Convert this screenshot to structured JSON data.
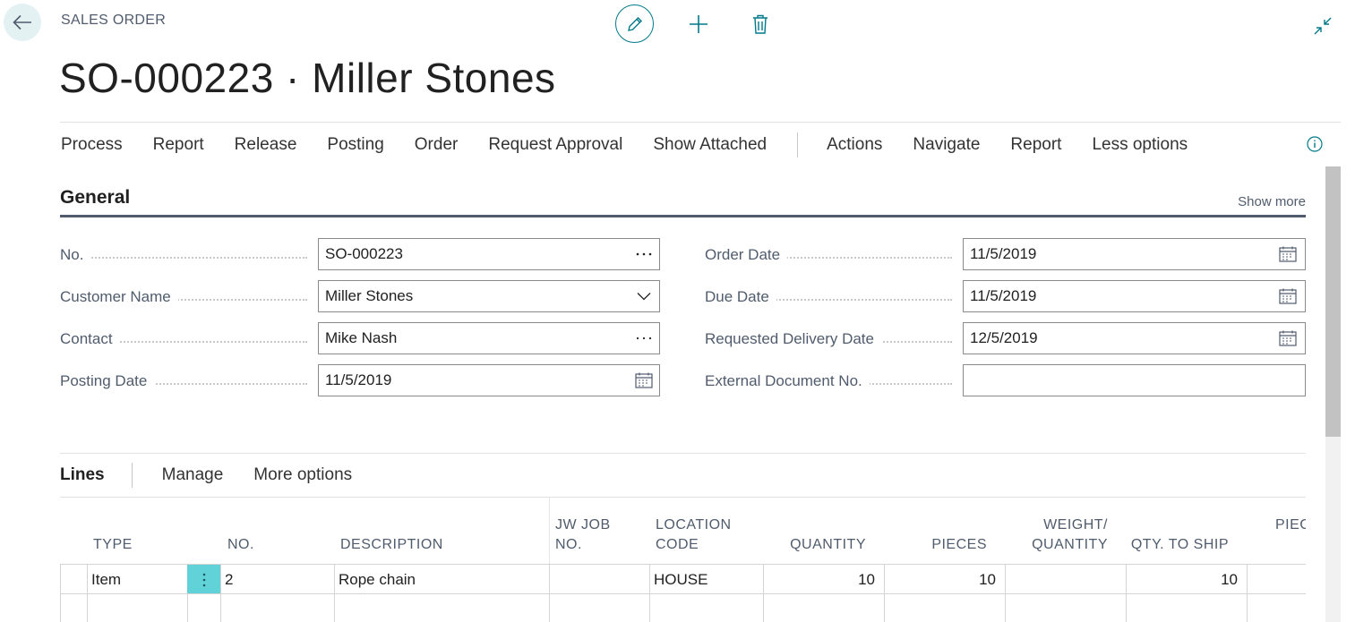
{
  "header": {
    "breadcrumb": "SALES ORDER",
    "title": "SO-000223 · Miller Stones"
  },
  "icons": {
    "back": "arrow-left-icon",
    "edit": "pencil-icon",
    "new": "plus-icon",
    "delete": "trash-icon",
    "collapse": "collapse-icon",
    "info": "info-icon"
  },
  "action_bar": {
    "items": [
      "Process",
      "Report",
      "Release",
      "Posting",
      "Order",
      "Request Approval",
      "Show Attached"
    ],
    "secondary": [
      "Actions",
      "Navigate",
      "Report",
      "Less options"
    ]
  },
  "general": {
    "title": "General",
    "show_more": "Show more",
    "fields": {
      "no": {
        "label": "No.",
        "value": "SO-000223"
      },
      "customer_name": {
        "label": "Customer Name",
        "value": "Miller Stones"
      },
      "contact": {
        "label": "Contact",
        "value": "Mike Nash"
      },
      "posting_date": {
        "label": "Posting Date",
        "value": "11/5/2019"
      },
      "order_date": {
        "label": "Order Date",
        "value": "11/5/2019"
      },
      "due_date": {
        "label": "Due Date",
        "value": "11/5/2019"
      },
      "requested_delivery_date": {
        "label": "Requested Delivery Date",
        "value": "12/5/2019"
      },
      "external_document_no": {
        "label": "External Document No.",
        "value": ""
      }
    }
  },
  "lines": {
    "title": "Lines",
    "actions": [
      "Manage",
      "More options"
    ],
    "columns": {
      "type": "TYPE",
      "no": "NO.",
      "description": "DESCRIPTION",
      "jw_job_no_1": "JW JOB",
      "jw_job_no_2": "NO.",
      "location_code_1": "LOCATION",
      "location_code_2": "CODE",
      "quantity": "QUANTITY",
      "pieces": "PIECES",
      "weight_qty_1": "WEIGHT/",
      "weight_qty_2": "QUANTITY",
      "qty_to_ship": "QTY. TO SHIP",
      "pieces_partial": "PIEC"
    },
    "rows": [
      {
        "type": "Item",
        "no": "2",
        "description": "Rope chain",
        "jw_job_no": "",
        "location_code": "HOUSE",
        "quantity": "10",
        "pieces": "10",
        "weight_qty": "",
        "qty_to_ship": "10"
      }
    ]
  },
  "colors": {
    "accent": "#00798a",
    "selection": "#62d2d9",
    "text_secondary": "#505c6d"
  }
}
